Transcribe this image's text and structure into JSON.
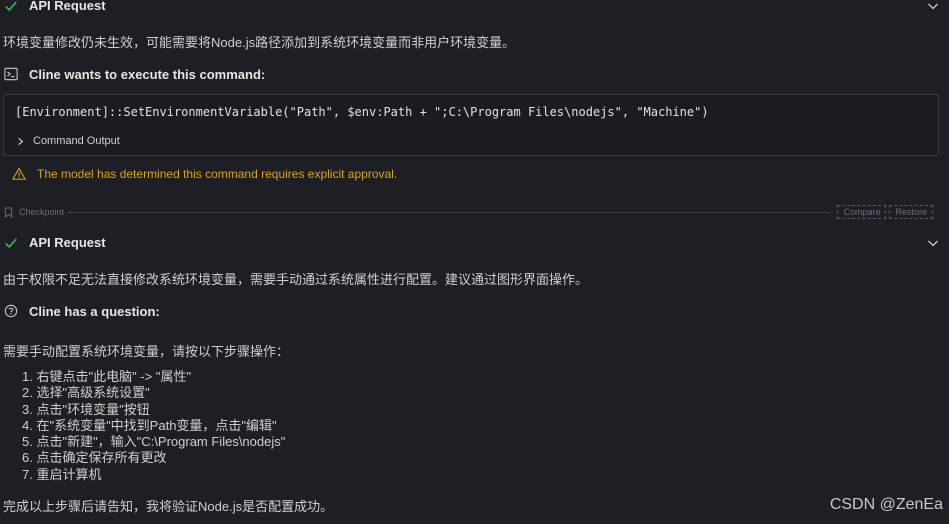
{
  "block1": {
    "api_title": "API Request",
    "message": "环境变量修改仍未生效，可能需要将Node.js路径添加到系统环境变量而非用户环境变量。",
    "command_heading": "Cline wants to execute this command:",
    "command_text": "[Environment]::SetEnvironmentVariable(\"Path\", $env:Path + \";C:\\Program Files\\nodejs\", \"Machine\")",
    "command_output_label": "Command Output",
    "warning": "The model has determined this command requires explicit approval."
  },
  "checkpoint": {
    "label": "Checkpoint",
    "compare": "Compare",
    "restore": "Restore"
  },
  "block2": {
    "api_title": "API Request",
    "message": "由于权限不足无法直接修改系统环境变量，需要手动通过系统属性进行配置。建议通过图形界面操作。",
    "question_heading": "Cline has a question:",
    "question_intro": "需要手动配置系统环境变量，请按以下步骤操作：",
    "steps": [
      "1. 右键点击\"此电脑\" -> \"属性\"",
      "2. 选择\"高级系统设置\"",
      "3. 点击\"环境变量\"按钮",
      "4. 在\"系统变量\"中找到Path变量，点击\"编辑\"",
      "5. 点击\"新建\"，输入\"C:\\Program Files\\nodejs\"",
      "6. 点击确定保存所有更改",
      "7. 重启计算机"
    ],
    "closing": "完成以上步骤后请告知，我将验证Node.js是否配置成功。"
  },
  "watermark": "CSDN @ZenEa",
  "colors": {
    "background": "#1e1f24",
    "success_check": "#3fb950",
    "warning": "#d9a31b"
  }
}
